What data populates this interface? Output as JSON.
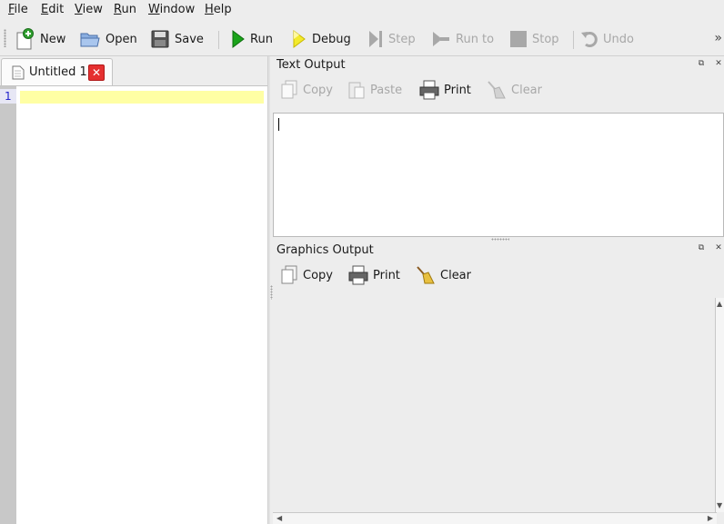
{
  "menu": [
    {
      "mnemonic": "F",
      "rest": "ile"
    },
    {
      "mnemonic": "E",
      "rest": "dit"
    },
    {
      "mnemonic": "V",
      "rest": "iew"
    },
    {
      "mnemonic": "R",
      "rest": "un"
    },
    {
      "mnemonic": "W",
      "rest": "indow"
    },
    {
      "mnemonic": "H",
      "rest": "elp"
    }
  ],
  "toolbar": {
    "new": "New",
    "open": "Open",
    "save": "Save",
    "run": "Run",
    "debug": "Debug",
    "step": "Step",
    "run_to": "Run to",
    "stop": "Stop",
    "undo": "Undo",
    "overflow": "»"
  },
  "editor": {
    "tab_title": "Untitled 1",
    "line_number": "1"
  },
  "text_output": {
    "title": "Text Output",
    "copy": "Copy",
    "paste": "Paste",
    "print": "Print",
    "clear": "Clear"
  },
  "graphics_output": {
    "title": "Graphics Output",
    "copy": "Copy",
    "print": "Print",
    "clear": "Clear"
  },
  "colors": {
    "current_line": "#ffffa4",
    "close_tab": "#e53030",
    "run_green": "#1aa31a",
    "line_number": "#2222cc"
  }
}
